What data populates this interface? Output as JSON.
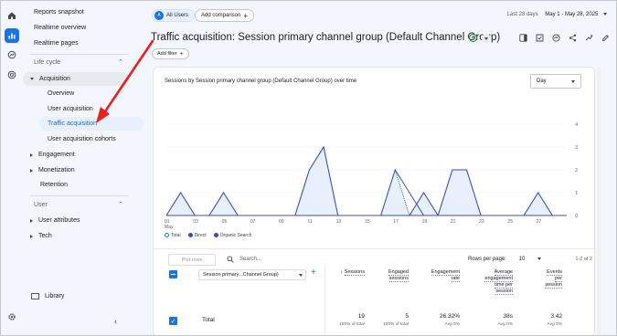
{
  "nav": {
    "items": [
      {
        "label": "Reports snapshot"
      },
      {
        "label": "Realtime overview"
      },
      {
        "label": "Realtime pages"
      }
    ],
    "section_lifecycle": "Life cycle",
    "acquisition": "Acquisition",
    "acq_children": [
      "Overview",
      "User acquisition",
      "Traffic acquisition",
      "User acquisition cohorts"
    ],
    "engagement": "Engagement",
    "monetization": "Monetization",
    "retention": "Retention",
    "section_user": "User",
    "user_attributes": "User attributes",
    "tech": "Tech",
    "library": "Library"
  },
  "topbar": {
    "all_users_badge": "A",
    "all_users": "All Users",
    "add_comparison": "Add comparison",
    "add_plus": "+",
    "date_hint": "Last 28 days",
    "date_range": "May 1 - May 28, 2025"
  },
  "title": {
    "text": "Traffic acquisition: Session primary channel group (Default Channel Group)",
    "check": "✓"
  },
  "add_filter": "Add filter",
  "add_filter_plus": "+",
  "card": {
    "chart_title": "Sessions by Session primary channel group (Default Channel Group) over time",
    "granularity": "Day"
  },
  "legend": [
    "Total",
    "Direct",
    "Organic Search"
  ],
  "table": {
    "plot_rows": "Plot rows",
    "search_placeholder": "Search...",
    "rows_per_page_label": "Rows per page:",
    "rows_per_page": "10",
    "page_count": "1-2 of 2",
    "dimension": "Session primary...Channel Group)",
    "add_dim": "+",
    "columns": [
      {
        "label_lines": [
          "Sessions"
        ],
        "arrow": "↓"
      },
      {
        "label_lines": [
          "Engaged",
          "sessions"
        ]
      },
      {
        "label_lines": [
          "Engagement",
          "rate"
        ]
      },
      {
        "label_lines": [
          "Average",
          "engagement",
          "time per",
          "session"
        ]
      },
      {
        "label_lines": [
          "Events",
          "per",
          "session"
        ]
      }
    ],
    "total_label": "Total",
    "totals": [
      {
        "value": "19",
        "sub": "100% of total"
      },
      {
        "value": "5",
        "sub": "100% of total"
      },
      {
        "value": "26.32%",
        "sub": "Avg 0%"
      },
      {
        "value": "38s",
        "sub": "Avg 0%"
      },
      {
        "value": "3.42",
        "sub": "Avg 0%"
      }
    ]
  },
  "chart_data": {
    "type": "area",
    "title": "Sessions by Session primary channel group (Default Channel Group) over time",
    "x_tick_labels": [
      "01\nMay",
      "03",
      "05",
      "07",
      "09",
      "11",
      "13",
      "15",
      "17",
      "19",
      "21",
      "23",
      "25",
      "27"
    ],
    "x_day_range": [
      1,
      29
    ],
    "y_ticks": [
      0,
      1,
      2,
      3,
      4
    ],
    "ylim": [
      0,
      4
    ],
    "grid": true,
    "legend": "bottom-left",
    "x": [
      1,
      2,
      3,
      4,
      5,
      6,
      7,
      8,
      9,
      10,
      11,
      12,
      13,
      14,
      15,
      16,
      17,
      18,
      19,
      20,
      21,
      22,
      23,
      24,
      25,
      26,
      27,
      28,
      29
    ],
    "series": [
      {
        "name": "Total",
        "values": [
          0,
          1,
          0,
          0,
          1,
          0,
          0,
          0,
          0,
          0,
          2,
          3,
          0,
          0,
          0,
          0,
          2,
          0,
          1,
          0,
          2,
          2,
          0,
          0,
          0,
          0,
          1,
          0,
          0
        ]
      },
      {
        "name": "Direct",
        "values": [
          0,
          1,
          0,
          0,
          1,
          0,
          0,
          0,
          0,
          0,
          2,
          3,
          0,
          0,
          0,
          0,
          2,
          0,
          1,
          0,
          2,
          2,
          0,
          0,
          0,
          0,
          1,
          0,
          0
        ]
      },
      {
        "name": "Organic Search",
        "values": [
          0,
          0,
          0,
          0,
          0,
          0,
          0,
          0,
          0,
          0,
          0,
          0,
          0,
          0,
          0,
          0,
          0,
          0,
          1,
          0,
          0,
          0,
          0,
          0,
          0,
          0,
          0,
          0,
          0
        ]
      }
    ],
    "colors": {
      "total": "#1a73e8",
      "direct": "#3c4bb5",
      "fill": "#e8f0fe"
    }
  }
}
